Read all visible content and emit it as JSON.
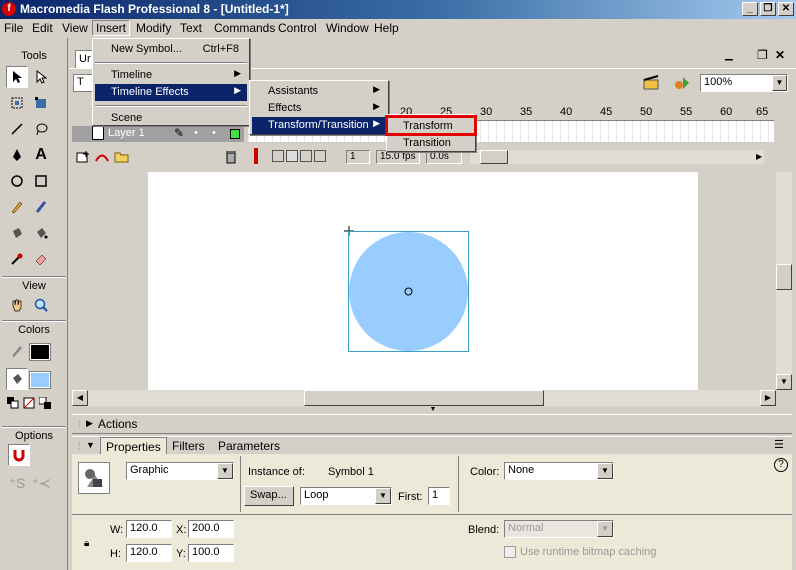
{
  "window": {
    "title": "Macromedia Flash Professional 8 - [Untitled-1*]",
    "app_icon": "f"
  },
  "menubar": [
    "File",
    "Edit",
    "View",
    "Insert",
    "Modify",
    "Text",
    "Commands",
    "Control",
    "Window",
    "Help"
  ],
  "toolbox": {
    "tools_label": "Tools",
    "view_label": "View",
    "colors_label": "Colors",
    "options_label": "Options"
  },
  "doc": {
    "tab_label": "Ur",
    "scene_initial": "T",
    "zoom": "100%"
  },
  "timeline": {
    "layer_name": "Layer 1",
    "ruler": [
      "20",
      "25",
      "30",
      "35",
      "40",
      "45",
      "50",
      "55",
      "60",
      "65"
    ],
    "current_frame": "1",
    "fps": "15.0 fps",
    "time": "0.0s"
  },
  "insert_menu": {
    "new_symbol": "New Symbol...",
    "new_symbol_shortcut": "Ctrl+F8",
    "timeline": "Timeline",
    "timeline_effects": "Timeline Effects",
    "scene": "Scene"
  },
  "effects_menu": {
    "assistants": "Assistants",
    "effects": "Effects",
    "transform_transition": "Transform/Transition"
  },
  "tt_menu": {
    "transform": "Transform",
    "transition": "Transition"
  },
  "panels": {
    "actions": "Actions",
    "tabs": {
      "properties": "Properties",
      "filters": "Filters",
      "parameters": "Parameters"
    },
    "symbol_type": "Graphic",
    "instance_of_label": "Instance of:",
    "instance_of": "Symbol 1",
    "swap": "Swap...",
    "loop": "Loop",
    "first_label": "First:",
    "first": "1",
    "color_label": "Color:",
    "color": "None",
    "w_label": "W:",
    "w": "120.0",
    "x_label": "X:",
    "x": "200.0",
    "h_label": "H:",
    "h": "120.0",
    "y_label": "Y:",
    "y": "100.0",
    "blend_label": "Blend:",
    "blend": "Normal",
    "cache_label": "Use runtime bitmap caching"
  },
  "colors": {
    "circle": "#99ccff",
    "highlight_box": "#e00000",
    "menu_highlight": "#0a246a"
  }
}
